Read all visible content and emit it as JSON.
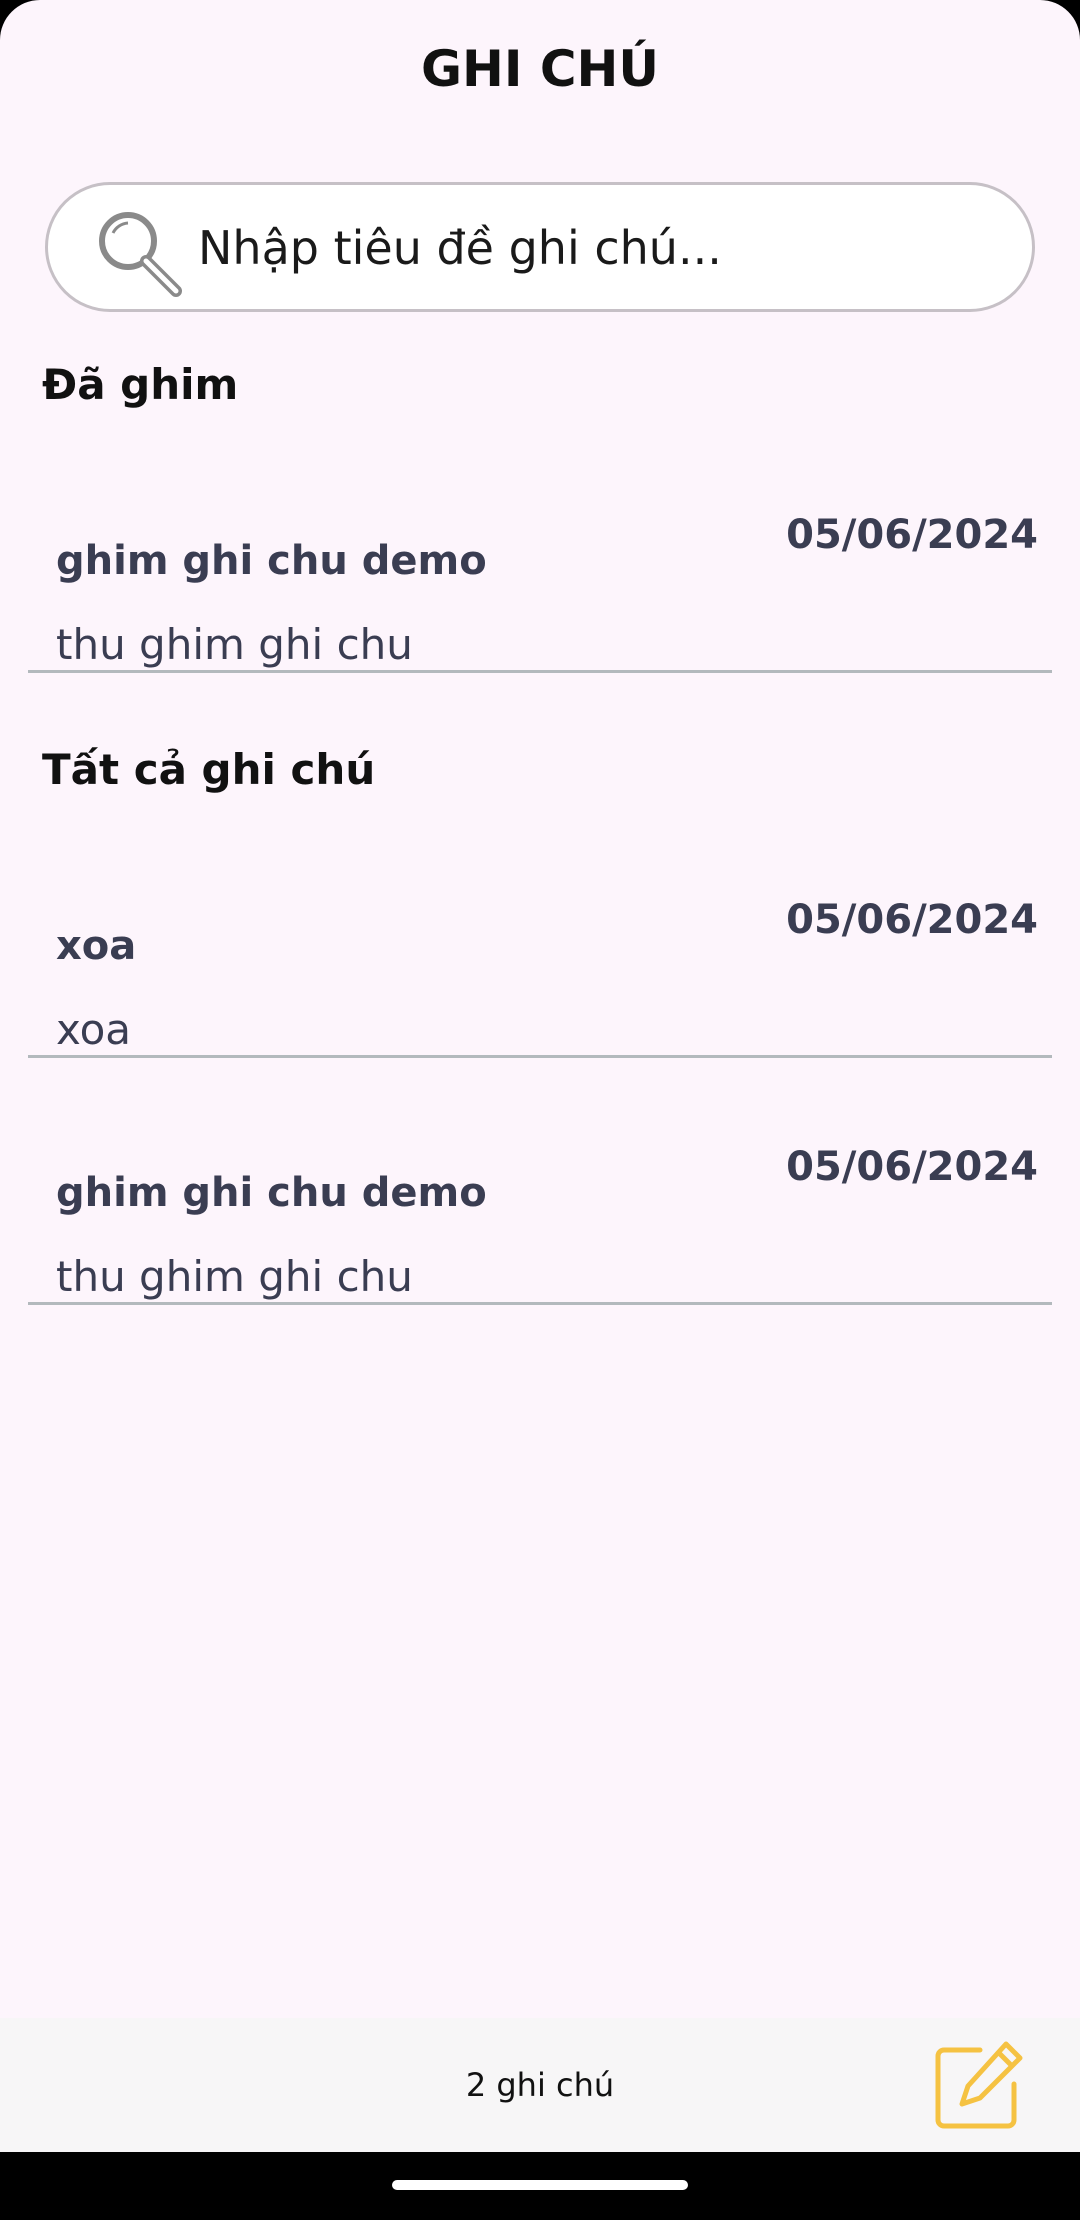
{
  "header": {
    "title": "GHI CHÚ"
  },
  "search": {
    "placeholder": "Nhập tiêu đề ghi chú...",
    "value": ""
  },
  "pinned": {
    "section_title": "Đã ghim",
    "notes": [
      {
        "title": "ghim ghi chu demo",
        "body": "thu ghim ghi chu",
        "date": "05/06/2024"
      }
    ]
  },
  "all_notes": {
    "section_title": "Tất cả ghi chú",
    "notes": [
      {
        "title": "xoa",
        "body": "xoa",
        "date": "05/06/2024"
      },
      {
        "title": "ghim ghi chu demo",
        "body": "thu ghim ghi chu",
        "date": "05/06/2024"
      }
    ]
  },
  "footer": {
    "count_label": "2 ghi chú"
  },
  "icons": {
    "search": "search-icon",
    "compose": "compose-icon"
  },
  "colors": {
    "accent": "#f5c242",
    "background": "#fdf5fc",
    "text_secondary": "#3a3d52"
  }
}
